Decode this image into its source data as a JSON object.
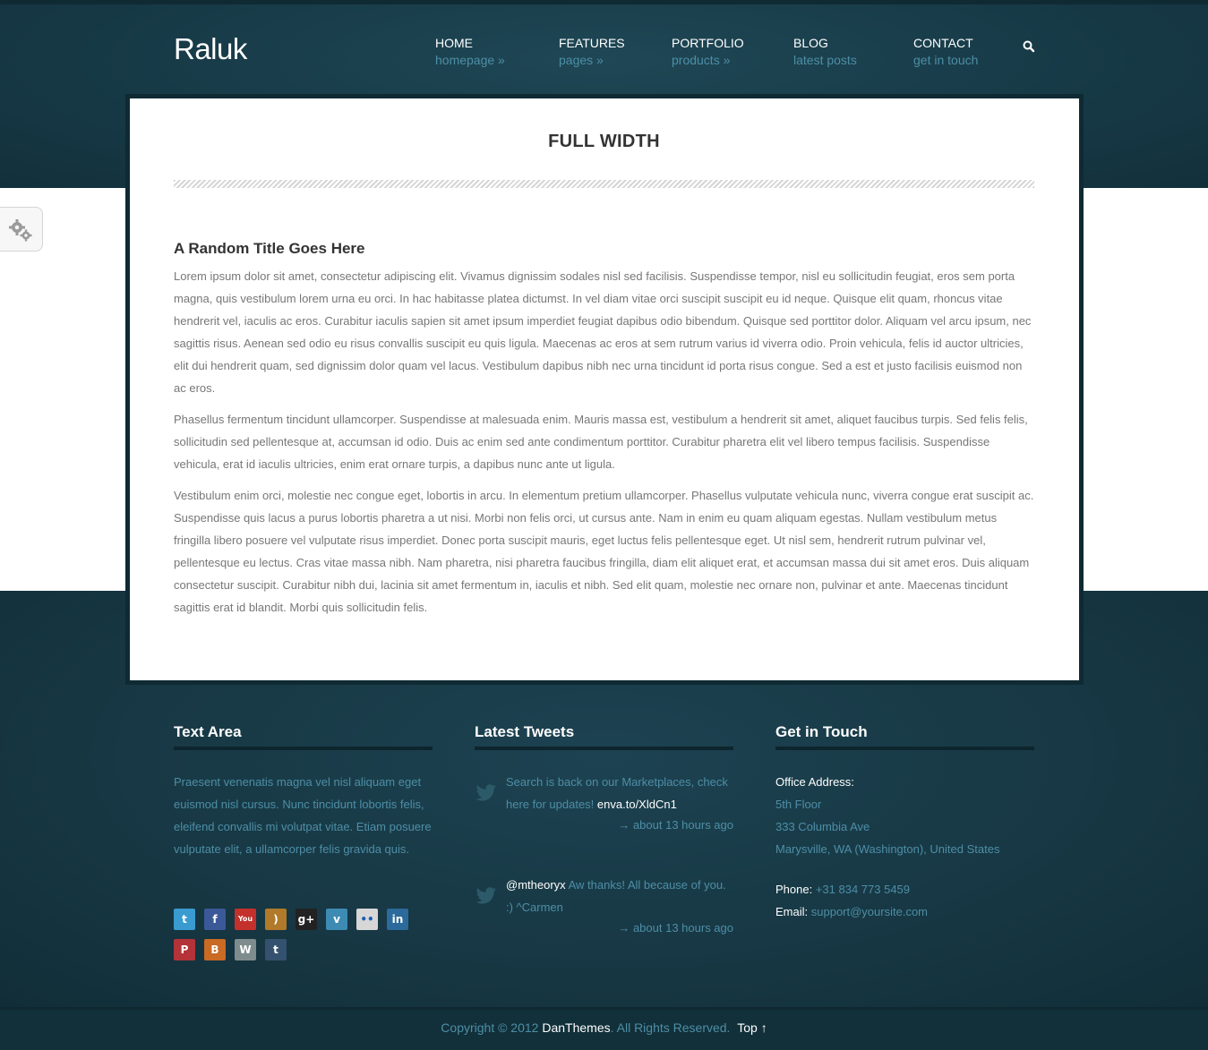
{
  "site": {
    "logo": "Raluk"
  },
  "nav": [
    {
      "title": "HOME",
      "sub": "homepage »"
    },
    {
      "title": "FEATURES",
      "sub": "pages »"
    },
    {
      "title": "PORTFOLIO",
      "sub": "products »"
    },
    {
      "title": "BLOG",
      "sub": "latest posts"
    },
    {
      "title": "CONTACT",
      "sub": "get in touch"
    }
  ],
  "page": {
    "title": "FULL WIDTH",
    "section_title": "A Random Title Goes Here",
    "paragraphs": [
      "Lorem ipsum dolor sit amet, consectetur adipiscing elit. Vivamus dignissim sodales nisl sed facilisis. Suspendisse tempor, nisl eu sollicitudin feugiat, eros sem porta magna, quis vestibulum lorem urna eu orci. In hac habitasse platea dictumst. In vel diam vitae orci suscipit suscipit eu id neque. Quisque elit quam, rhoncus vitae hendrerit vel, iaculis ac eros. Curabitur iaculis sapien sit amet ipsum imperdiet feugiat dapibus odio bibendum. Quisque sed porttitor dolor. Aliquam vel arcu ipsum, nec sagittis risus. Aenean sed odio eu risus convallis suscipit eu quis ligula. Maecenas ac eros at sem rutrum varius id viverra odio. Proin vehicula, felis id auctor ultricies, elit dui hendrerit quam, sed dignissim dolor quam vel lacus. Vestibulum dapibus nibh nec urna tincidunt id porta risus congue. Sed a est et justo facilisis euismod non ac eros.",
      "Phasellus fermentum tincidunt ullamcorper. Suspendisse at malesuada enim. Mauris massa est, vestibulum a hendrerit sit amet, aliquet faucibus turpis. Sed felis felis, sollicitudin sed pellentesque at, accumsan id odio. Duis ac enim sed ante condimentum porttitor. Curabitur pharetra elit vel libero tempus facilisis. Suspendisse vehicula, erat id iaculis ultricies, enim erat ornare turpis, a dapibus nunc ante ut ligula.",
      "Vestibulum enim orci, molestie nec congue eget, lobortis in arcu. In elementum pretium ullamcorper. Phasellus vulputate vehicula nunc, viverra congue erat suscipit ac. Suspendisse quis lacus a purus lobortis pharetra a ut nisi. Morbi non felis orci, ut cursus ante. Nam in enim eu quam aliquam egestas. Nullam vestibulum metus fringilla libero posuere vel vulputate risus imperdiet. Donec porta suscipit mauris, eget luctus felis pellentesque eget. Ut nisl sem, hendrerit rutrum pulvinar vel, pellentesque eu lectus. Cras vitae massa nibh. Nam pharetra, nisi pharetra faucibus fringilla, diam elit aliquet erat, et accumsan massa dui sit amet eros. Duis aliquam consectetur suscipit. Curabitur nibh dui, lacinia sit amet fermentum in, iaculis et nibh. Sed elit quam, molestie nec ornare non, pulvinar et ante. Maecenas tincidunt sagittis erat id blandit. Morbi quis sollicitudin felis."
    ]
  },
  "footer": {
    "text_area": {
      "title": "Text Area",
      "body": "Praesent venenatis magna vel nisl aliquam eget euismod nisl cursus. Nunc tincidunt lobortis felis, eleifend convallis mi volutpat vitae. Etiam posuere vulputate elit, a ullamcorper felis gravida quis."
    },
    "social_icons": [
      {
        "name": "twitter-icon",
        "glyph": "t",
        "color": "#3a9bd1"
      },
      {
        "name": "facebook-icon",
        "glyph": "f",
        "color": "#3b5998"
      },
      {
        "name": "youtube-icon",
        "glyph": "You",
        "color": "#c4302b"
      },
      {
        "name": "rss-icon",
        "glyph": ")",
        "color": "#b07a2a"
      },
      {
        "name": "google-plus-icon",
        "glyph": "g+",
        "color": "#222222"
      },
      {
        "name": "vimeo-icon",
        "glyph": "v",
        "color": "#3d8bb3"
      },
      {
        "name": "flickr-icon",
        "glyph": "••",
        "color": "#d7d7d7"
      },
      {
        "name": "linkedin-icon",
        "glyph": "in",
        "color": "#2b6a9b"
      },
      {
        "name": "pinterest-icon",
        "glyph": "P",
        "color": "#b33339"
      },
      {
        "name": "blogger-icon",
        "glyph": "B",
        "color": "#c96a25"
      },
      {
        "name": "wordpress-icon",
        "glyph": "W",
        "color": "#7f8c8d"
      },
      {
        "name": "tumblr-icon",
        "glyph": "t",
        "color": "#34526f"
      }
    ],
    "tweets": {
      "title": "Latest Tweets",
      "items": [
        {
          "text": "Search is back on our Marketplaces, check here for updates!",
          "link": "enva.to/XldCn1",
          "time": "→ about 13 hours ago"
        },
        {
          "handle": "@mtheoryx",
          "text": "Aw thanks! All because of you. :) ^Carmen",
          "time": "→ about 13 hours ago"
        }
      ]
    },
    "contact": {
      "title": "Get in Touch",
      "office_label": "Office Address:",
      "address_lines": [
        "5th Floor",
        "333 Columbia Ave",
        "Marysville, WA (Washington), United States"
      ],
      "phone_label": "Phone:",
      "phone": "+31 834 773 5459",
      "email_label": "Email:",
      "email": "support@yoursite.com"
    }
  },
  "bottom": {
    "copyright": "Copyright © 2012",
    "brand": "DanThemes",
    "rights": ". All Rights Reserved.",
    "top_link": "Top ↑"
  }
}
